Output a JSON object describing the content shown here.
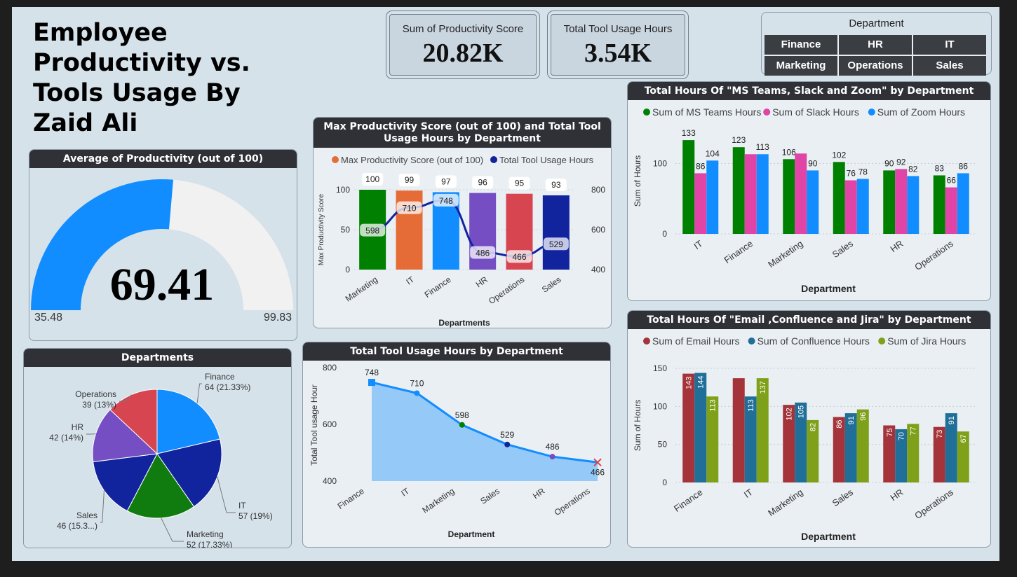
{
  "title": "Employee Productivity vs. Tools Usage By Zaid Ali",
  "kpis": [
    {
      "label": "Sum of Productivity Score",
      "value": "20.82K"
    },
    {
      "label": "Total Tool Usage Hours",
      "value": "3.54K"
    }
  ],
  "slicer": {
    "title": "Department",
    "options": [
      "Finance",
      "HR",
      "IT",
      "Marketing",
      "Operations",
      "Sales"
    ]
  },
  "gauge": {
    "title": "Average of Productivity (out of 100)",
    "value": 69.41,
    "value_label": "69.41",
    "min": 35.48,
    "max": 99.83,
    "min_label": "35.48",
    "max_label": "99.83",
    "fill_color": "#118dff",
    "track_color": "#f1f1f1"
  },
  "colors": {
    "blue": "#118dff",
    "navy": "#12239e",
    "green": "#008000",
    "orange": "#e66c37",
    "purple": "#744ec2",
    "red": "#d64550",
    "pink": "#e044a7",
    "maroon": "#a4343a",
    "teal": "#1f6f98",
    "olive": "#7fa019"
  },
  "chart_data": [
    {
      "id": "pie",
      "type": "pie",
      "title": "Departments",
      "slices": [
        {
          "label": "Finance",
          "value": 64,
          "text": "64 (21.33%)",
          "color": "#118dff"
        },
        {
          "label": "IT",
          "value": 57,
          "text": "57 (19%)",
          "color": "#12239e"
        },
        {
          "label": "Marketing",
          "value": 52,
          "text": "52 (17.33%)",
          "color": "#107c10"
        },
        {
          "label": "Sales",
          "value": 46,
          "text": "46 (15.3...)",
          "color": "#12239e"
        },
        {
          "label": "HR",
          "value": 42,
          "text": "42 (14%)",
          "color": "#744ec2"
        },
        {
          "label": "Operations",
          "value": 39,
          "text": "39 (13%)",
          "color": "#d64550"
        }
      ]
    },
    {
      "id": "combo",
      "type": "bar",
      "title": "Max Productivity Score (out of 100) and Total Tool Usage Hours by Department",
      "categories": [
        "Marketing",
        "IT",
        "Finance",
        "HR",
        "Operations",
        "Sales"
      ],
      "series": [
        {
          "name": "Max Productivity Score (out of 100)",
          "values": [
            100,
            99,
            97,
            96,
            95,
            93
          ],
          "colors": [
            "#008000",
            "#e66c37",
            "#118dff",
            "#744ec2",
            "#d64550",
            "#12239e"
          ],
          "legend_color": "#e66c37"
        },
        {
          "name": "Total Tool Usage Hours",
          "values": [
            598,
            710,
            748,
            486,
            466,
            529
          ],
          "color": "#12239e",
          "type": "line"
        }
      ],
      "xlabel": "Departments",
      "ylabel": "Max Productivity Score",
      "ylim": [
        0,
        100
      ],
      "yticks": [
        0,
        50,
        100
      ],
      "y2lim": [
        400,
        800
      ],
      "y2ticks": [
        400,
        600,
        800
      ]
    },
    {
      "id": "area",
      "type": "area",
      "title": "Total Tool Usage Hours by Department",
      "categories": [
        "Finance",
        "IT",
        "Marketing",
        "Sales",
        "HR",
        "Operations"
      ],
      "values": [
        748,
        710,
        598,
        529,
        486,
        466
      ],
      "xlabel": "Department",
      "ylabel": "Total Tool usage Hour",
      "ylim": [
        400,
        800
      ],
      "yticks": [
        400,
        600,
        800
      ]
    },
    {
      "id": "comm",
      "type": "bar",
      "title": "Total Hours Of \"MS Teams, Slack and Zoom\" by Department",
      "categories": [
        "IT",
        "Finance",
        "Marketing",
        "Sales",
        "HR",
        "Operations"
      ],
      "series": [
        {
          "name": "Sum of MS Teams Hours",
          "values": [
            133,
            123,
            106,
            102,
            90,
            83
          ],
          "color": "#008000"
        },
        {
          "name": "Sum of Slack Hours",
          "values": [
            86,
            113,
            114,
            76,
            92,
            66
          ],
          "color": "#e044a7"
        },
        {
          "name": "Sum of Zoom Hours",
          "values": [
            104,
            113,
            90,
            78,
            82,
            86
          ],
          "color": "#118dff"
        }
      ],
      "value_labels": [
        [
          "133",
          "86",
          "104"
        ],
        [
          "123",
          "",
          "113"
        ],
        [
          "106",
          "",
          "90"
        ],
        [
          "102",
          "76",
          "78"
        ],
        [
          "90",
          "92",
          "82"
        ],
        [
          "83",
          "66",
          "86"
        ]
      ],
      "xlabel": "Department",
      "ylabel": "Sum of Hours",
      "ylim": [
        0,
        150
      ],
      "yticks": [
        0,
        100
      ]
    },
    {
      "id": "prod",
      "type": "bar",
      "title": "Total Hours Of \"Email ,Confluence and Jira\" by Department",
      "categories": [
        "Finance",
        "IT",
        "Marketing",
        "Sales",
        "HR",
        "Operations"
      ],
      "series": [
        {
          "name": "Sum of Email Hours",
          "values": [
            143,
            137,
            102,
            86,
            75,
            73
          ],
          "color": "#a4343a"
        },
        {
          "name": "Sum of Confluence Hours",
          "values": [
            144,
            113,
            105,
            91,
            70,
            91
          ],
          "color": "#1f6f98"
        },
        {
          "name": "Sum of Jira Hours",
          "values": [
            113,
            137,
            82,
            96,
            77,
            67
          ],
          "color": "#7fa019"
        }
      ],
      "value_labels": [
        [
          "143",
          "144",
          "113"
        ],
        [
          "",
          "113",
          "137"
        ],
        [
          "102",
          "105",
          "82"
        ],
        [
          "86",
          "91",
          "96"
        ],
        [
          "75",
          "70",
          "77"
        ],
        [
          "73",
          "91",
          "67"
        ]
      ],
      "xlabel": "Department",
      "ylabel": "Sum of Hours",
      "ylim": [
        0,
        150
      ],
      "yticks": [
        0,
        50,
        100,
        150
      ]
    }
  ]
}
